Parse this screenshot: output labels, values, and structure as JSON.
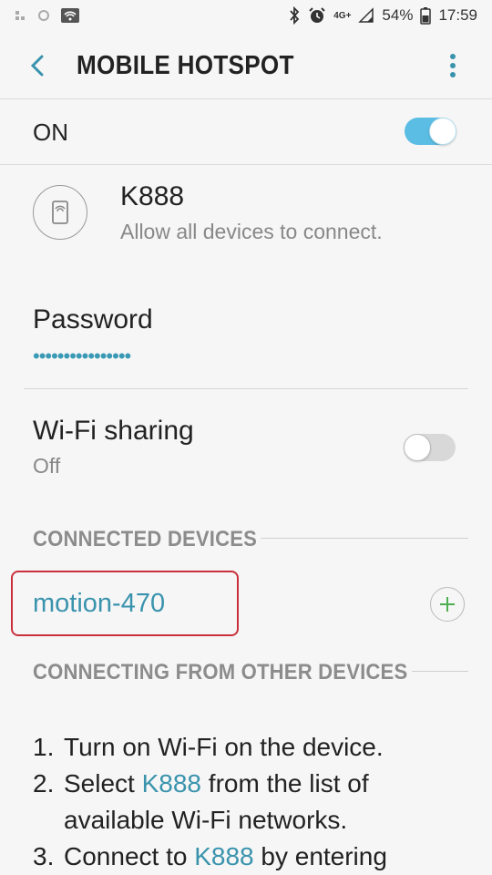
{
  "status_bar": {
    "battery": "54%",
    "time": "17:59",
    "network": "4G+"
  },
  "header": {
    "title": "MOBILE HOTSPOT",
    "back_icon": "chevron-left-icon",
    "more_icon": "more-vert-icon"
  },
  "hotspot": {
    "label": "ON",
    "enabled": true,
    "accent": "#5bbde4"
  },
  "network": {
    "name": "K888",
    "subtitle": "Allow all devices to connect.",
    "icon": "phone-hotspot-icon"
  },
  "password": {
    "label": "Password",
    "value": "••••••••••••••••"
  },
  "wifi_sharing": {
    "label": "Wi-Fi sharing",
    "status": "Off",
    "enabled": false
  },
  "connected_devices": {
    "header": "CONNECTED DEVICES",
    "devices": [
      {
        "name": "motion-470",
        "highlight_color": "#c9303c"
      }
    ]
  },
  "connecting": {
    "header": "CONNECTING FROM OTHER DEVICES",
    "steps": [
      {
        "num": "1.",
        "text": "Turn on Wi-Fi on the device."
      },
      {
        "num": "2.",
        "pre": "Select ",
        "link": "K888",
        "post": " from the list of",
        "cont": "available Wi-Fi networks."
      },
      {
        "num": "3.",
        "pre": "Connect to ",
        "link": "K888",
        "post": " by entering"
      }
    ]
  }
}
